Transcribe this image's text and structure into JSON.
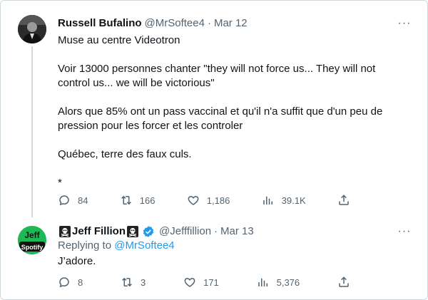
{
  "tweets": [
    {
      "author_name": "Russell Bufalino",
      "handle": "@MrSoftee4",
      "date": "Mar 12",
      "text": [
        "Muse au centre Videotron",
        "Voir 13000 personnes chanter \"they will not force us... They will not control us... we will be victorious\"",
        "Alors que 85% ont un pass vaccinal et qu'il n'a suffit que d'un peu de pression pour les forcer et les controler",
        "Québec, terre des faux culs.",
        "*"
      ],
      "stats": {
        "replies": "84",
        "retweets": "166",
        "likes": "1,186",
        "views": "39.1K"
      }
    },
    {
      "author_name": "Jeff Fillion",
      "handle": "@Jefffillion",
      "date": "Mar 13",
      "avatar_text_top": "Jeff",
      "avatar_text_bottom": "Spotify",
      "replying_prefix": "Replying to",
      "replying_handle": "@MrSoftee4",
      "text": "J’adore.",
      "stats": {
        "replies": "8",
        "retweets": "3",
        "likes": "171",
        "views": "5,376"
      }
    }
  ],
  "more_label": "···",
  "date_separator": "·",
  "icons": [
    "reply-icon",
    "retweet-icon",
    "like-icon",
    "views-icon",
    "share-icon",
    "verified-badge-icon",
    "skull-flag-icon"
  ],
  "colors": {
    "muted": "#536471",
    "link": "#1d9bf0",
    "verified": "#1d9bf0",
    "spotify": "#1db954",
    "text": "#0f1419"
  }
}
